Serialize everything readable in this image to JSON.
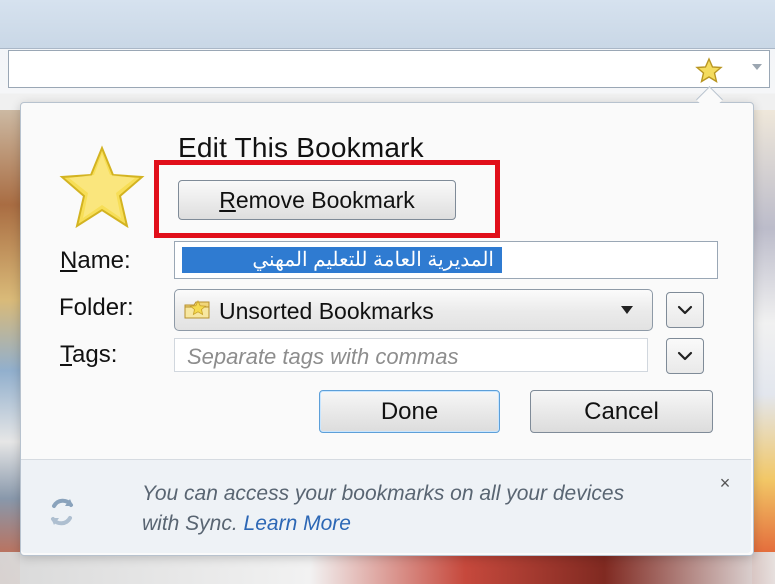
{
  "bookmark_panel": {
    "title": "Edit This Bookmark",
    "remove_button": "Remove Bookmark",
    "labels": {
      "name": "Name:",
      "folder": "Folder:",
      "tags": "Tags:"
    },
    "fields": {
      "name_value": "المديرية العامة للتعليم المهني",
      "folder_value": "Unsorted Bookmarks",
      "tags_placeholder": "Separate tags with commas"
    },
    "buttons": {
      "done": "Done",
      "cancel": "Cancel"
    },
    "sync_message": {
      "text": "You can access your bookmarks on all your devices with Sync.",
      "link": "Learn More"
    },
    "close_symbol": "×"
  },
  "colors": {
    "highlight_red": "#e10f1a",
    "selection_blue": "#2f7bd1",
    "link_blue": "#2c67b5",
    "footer_background": "#eef2f6"
  },
  "icons": {
    "toolbar_star": "star-icon",
    "panel_star": "star-icon",
    "folder": "folder-icon",
    "sync": "sync-icon",
    "dropdown": "chevron-down-icon",
    "close": "close-icon"
  }
}
